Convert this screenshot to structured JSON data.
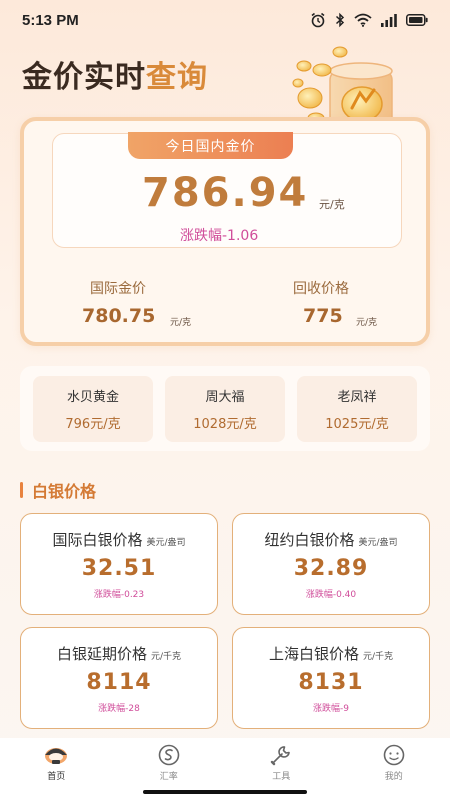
{
  "status_bar": {
    "time": "5:13 PM"
  },
  "header": {
    "title_main": "金价实时",
    "title_accent": "查询"
  },
  "today": {
    "tag": "今日国内金价",
    "price": "786.94",
    "unit": "元/克",
    "change": "涨跌幅-1.06"
  },
  "international": {
    "label": "国际金价",
    "value": "780.75",
    "unit": "元/克"
  },
  "recycle": {
    "label": "回收价格",
    "value": "775",
    "unit": "元/克"
  },
  "brands": [
    {
      "name": "水贝黄金",
      "price": "796元/克"
    },
    {
      "name": "周大福",
      "price": "1028元/克"
    },
    {
      "name": "老凤祥",
      "price": "1025元/克"
    }
  ],
  "silver_section": {
    "title": "白银价格"
  },
  "silver": [
    {
      "name": "国际白银价格",
      "unit": "美元/盎司",
      "value": "32.51",
      "change": "涨跌幅-0.23"
    },
    {
      "name": "纽约白银价格",
      "unit": "美元/盎司",
      "value": "32.89",
      "change": "涨跌幅-0.40"
    },
    {
      "name": "白银延期价格",
      "unit": "元/千克",
      "value": "8114",
      "change": "涨跌幅-28"
    },
    {
      "name": "上海白银价格",
      "unit": "元/千克",
      "value": "8131",
      "change": "涨跌幅-9"
    }
  ],
  "nav": [
    {
      "label": "首页",
      "icon": "home-icon"
    },
    {
      "label": "汇率",
      "icon": "exchange-icon"
    },
    {
      "label": "工具",
      "icon": "wrench-icon"
    },
    {
      "label": "我的",
      "icon": "profile-icon"
    }
  ],
  "colors": {
    "accent": "#d98a3a",
    "price": "#c07c3c",
    "change": "#d04d9a",
    "tag_gradient_start": "#f0a467",
    "tag_gradient_end": "#ec7f52"
  }
}
